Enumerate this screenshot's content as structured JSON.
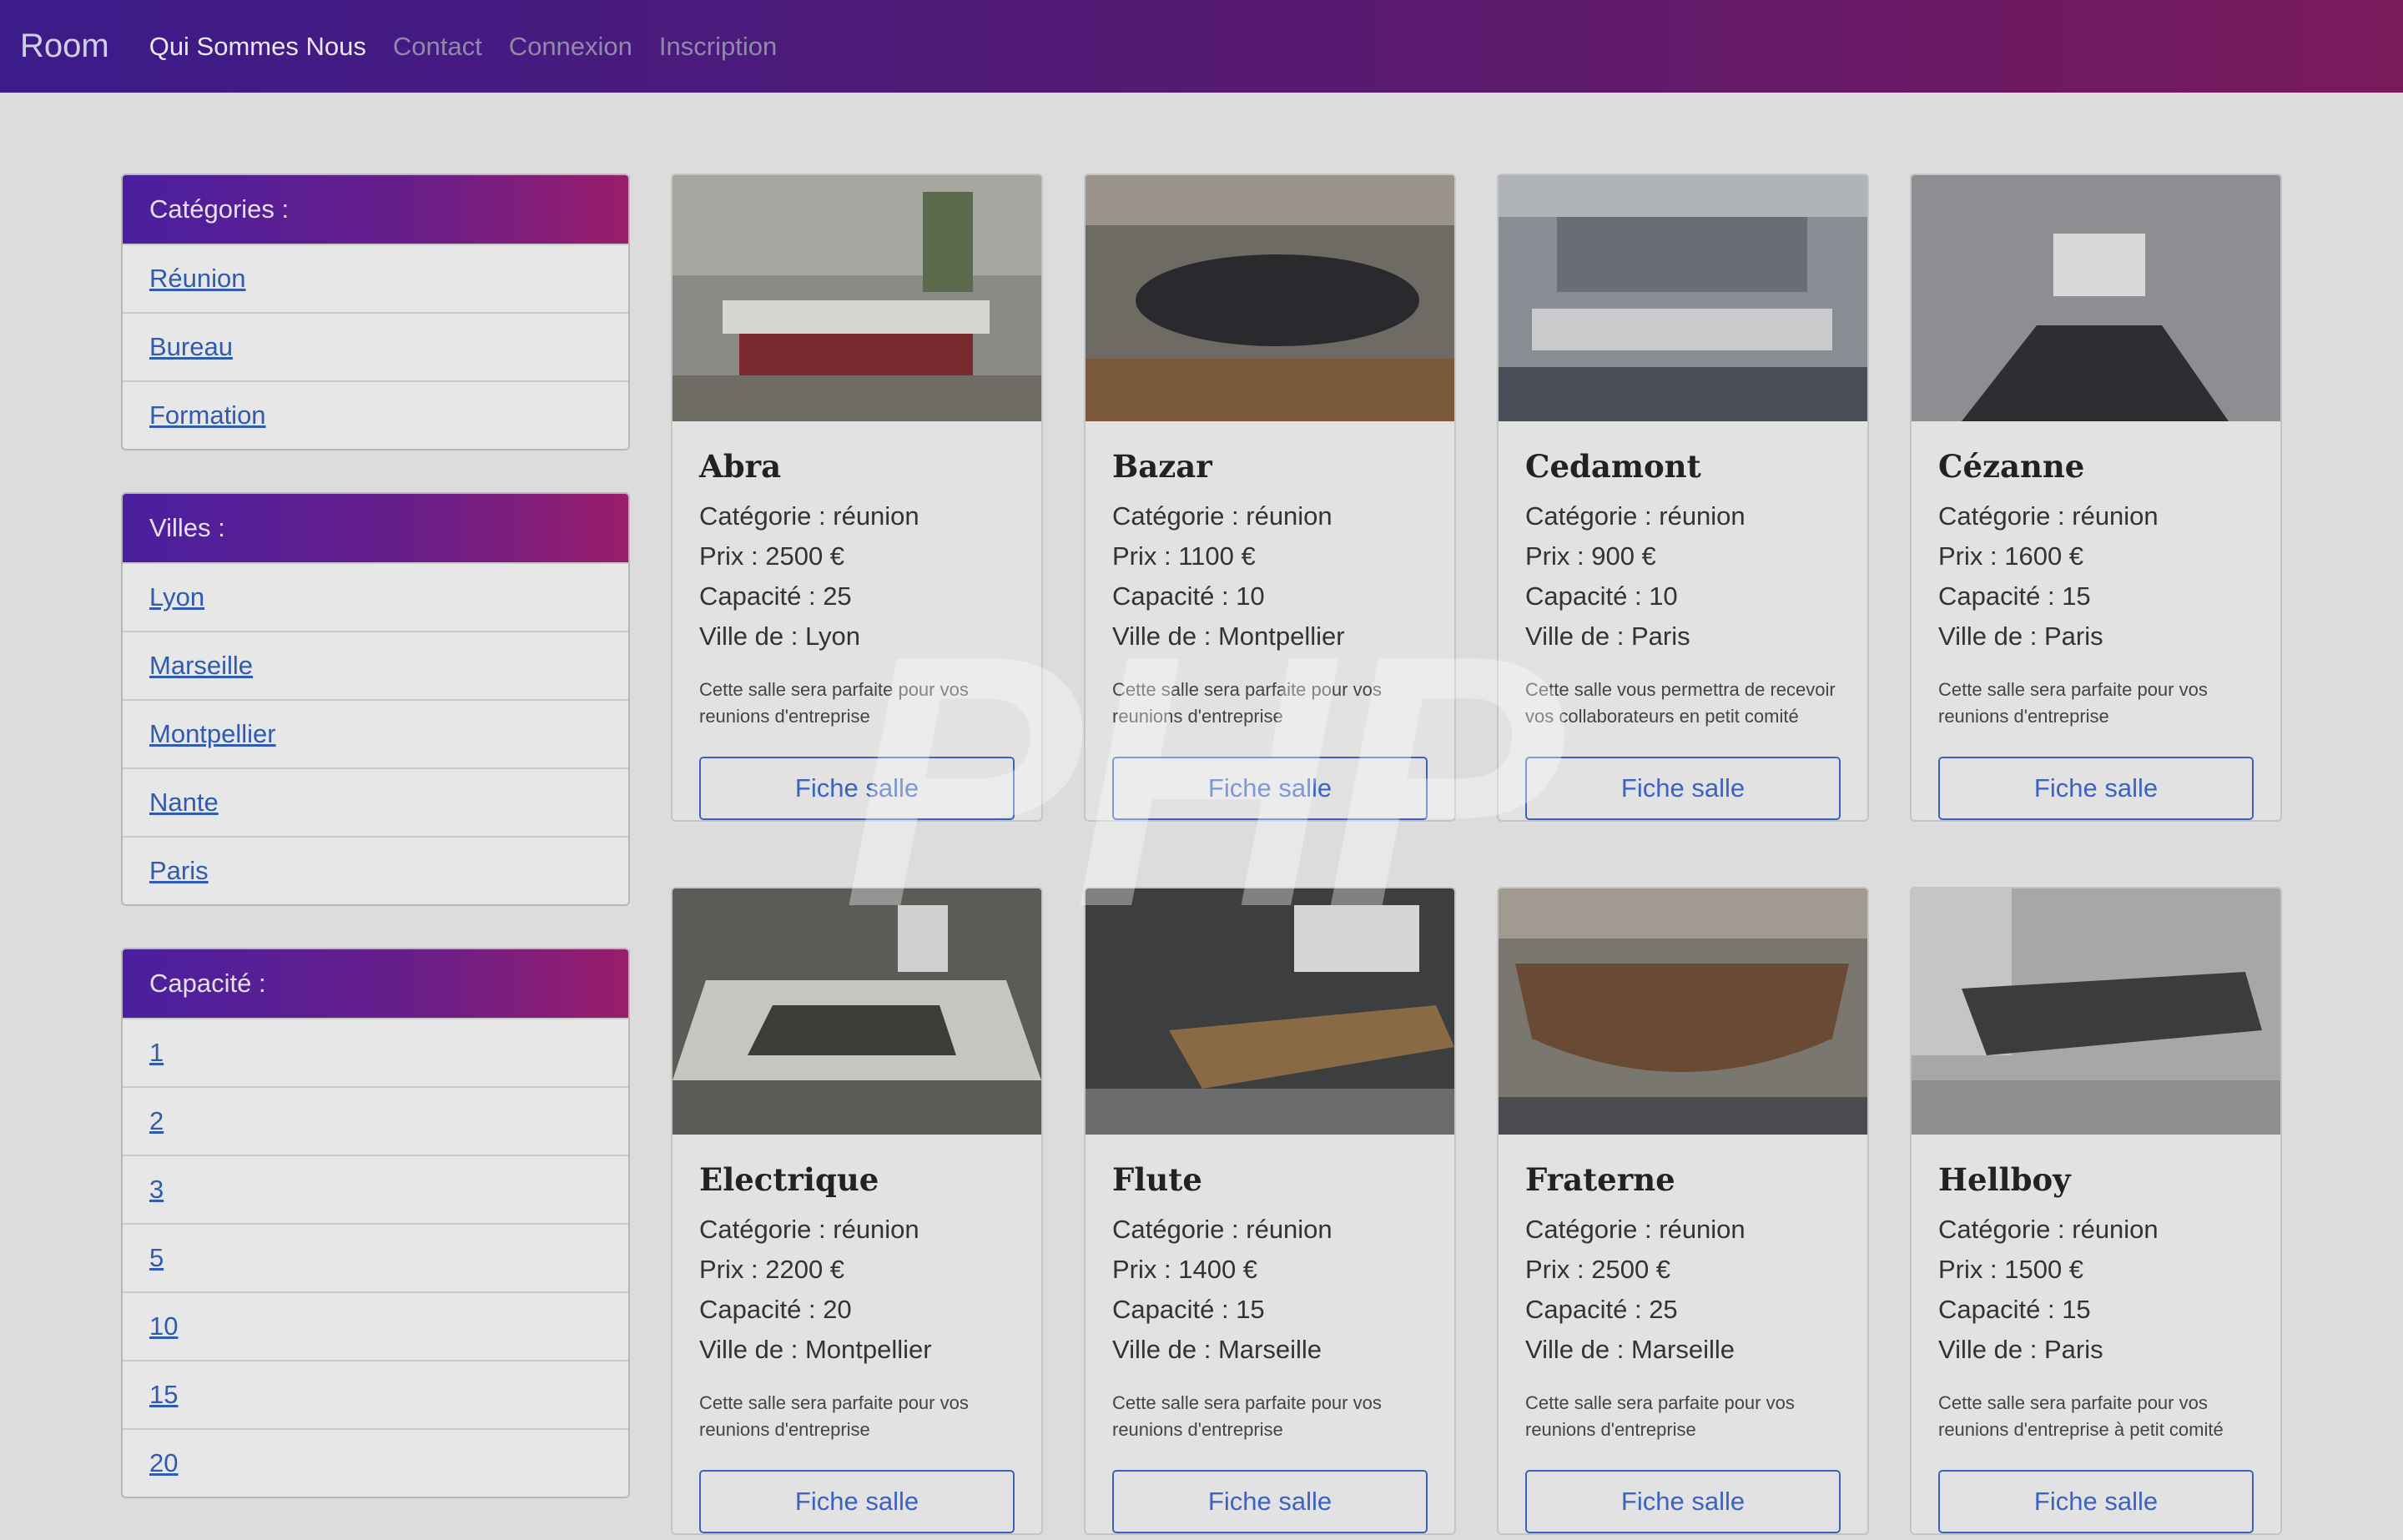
{
  "navbar": {
    "brand": "Room",
    "links": [
      "Qui Sommes Nous",
      "Contact",
      "Connexion",
      "Inscription"
    ]
  },
  "sidebar": {
    "categories": {
      "title": "Catégories :",
      "items": [
        "Réunion",
        "Bureau",
        "Formation"
      ]
    },
    "villes": {
      "title": "Villes :",
      "items": [
        "Lyon",
        "Marseille",
        "Montpellier",
        "Nante",
        "Paris"
      ]
    },
    "capacite": {
      "title": "Capacité :",
      "items": [
        "1",
        "2",
        "3",
        "5",
        "10",
        "15",
        "20"
      ]
    }
  },
  "watermark": "PHP",
  "cards": [
    {
      "name": "Abra",
      "categorie": "Catégorie : réunion",
      "prix": "Prix : 2500 €",
      "capacite": "Capacité : 25",
      "ville": "Ville de : Lyon",
      "desc": "Cette salle sera parfaite pour vos reunions d'entreprise",
      "button": "Fiche salle"
    },
    {
      "name": "Bazar",
      "categorie": "Catégorie : réunion",
      "prix": "Prix : 1100 €",
      "capacite": "Capacité : 10",
      "ville": "Ville de : Montpellier",
      "desc": "Cette salle sera parfaite pour vos reunions d'entreprise",
      "button": "Fiche salle"
    },
    {
      "name": "Cedamont",
      "categorie": "Catégorie : réunion",
      "prix": "Prix : 900 €",
      "capacite": "Capacité : 10",
      "ville": "Ville de : Paris",
      "desc": "Cette salle vous permettra de recevoir vos collaborateurs en petit comité",
      "button": "Fiche salle"
    },
    {
      "name": "Cézanne",
      "categorie": "Catégorie : réunion",
      "prix": "Prix : 1600 €",
      "capacite": "Capacité : 15",
      "ville": "Ville de : Paris",
      "desc": "Cette salle sera parfaite pour vos reunions d'entreprise",
      "button": "Fiche salle"
    },
    {
      "name": "Electrique",
      "categorie": "Catégorie : réunion",
      "prix": "Prix : 2200 €",
      "capacite": "Capacité : 20",
      "ville": "Ville de : Montpellier",
      "desc": "Cette salle sera parfaite pour vos reunions d'entreprise",
      "button": "Fiche salle"
    },
    {
      "name": "Flute",
      "categorie": "Catégorie : réunion",
      "prix": "Prix : 1400 €",
      "capacite": "Capacité : 15",
      "ville": "Ville de : Marseille",
      "desc": "Cette salle sera parfaite pour vos reunions d'entreprise",
      "button": "Fiche salle"
    },
    {
      "name": "Fraterne",
      "categorie": "Catégorie : réunion",
      "prix": "Prix : 2500 €",
      "capacite": "Capacité : 25",
      "ville": "Ville de : Marseille",
      "desc": "Cette salle sera parfaite pour vos reunions d'entreprise",
      "button": "Fiche salle"
    },
    {
      "name": "Hellboy",
      "categorie": "Catégorie : réunion",
      "prix": "Prix : 1500 €",
      "capacite": "Capacité : 15",
      "ville": "Ville de : Paris",
      "desc": "Cette salle sera parfaite pour vos reunions d'entreprise à petit comité",
      "button": "Fiche salle"
    }
  ]
}
